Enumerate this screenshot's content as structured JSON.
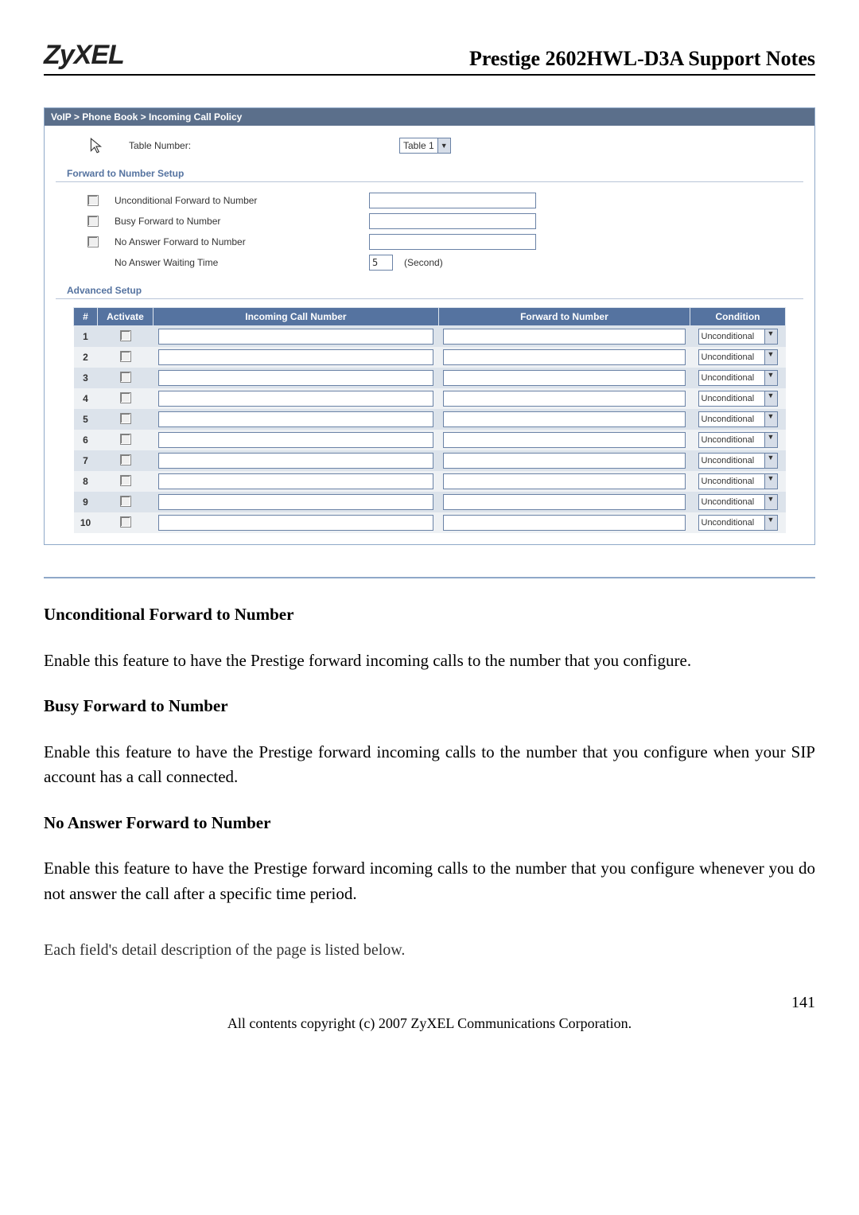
{
  "header": {
    "brand": "ZyXEL",
    "doc_title": "Prestige 2602HWL-D3A Support Notes"
  },
  "breadcrumb": {
    "part1": "VoIP",
    "sep": ">",
    "part2": "Phone Book",
    "part3": "Incoming Call Policy"
  },
  "top": {
    "table_number_label": "Table Number:",
    "table_number_value": "Table 1"
  },
  "fwd_setup": {
    "section": "Forward to Number Setup",
    "row1": "Unconditional Forward to Number",
    "row2": "Busy Forward to Number",
    "row3": "No Answer Forward to Number",
    "row4": "No Answer Waiting Time",
    "wait_val": "5",
    "wait_unit": "(Second)"
  },
  "adv": {
    "section": "Advanced Setup",
    "col_hash": "#",
    "col_activate": "Activate",
    "col_incoming": "Incoming Call Number",
    "col_fwd": "Forward to Number",
    "col_cond": "Condition",
    "cond_val": "Unconditional",
    "rows": [
      "1",
      "2",
      "3",
      "4",
      "5",
      "6",
      "7",
      "8",
      "9",
      "10"
    ]
  },
  "desc": {
    "h1": "Unconditional Forward to Number",
    "p1": "Enable this feature to have the Prestige forward incoming calls to the number that you configure.",
    "h2": "Busy Forward to Number",
    "p2": "Enable this feature to have the Prestige forward incoming calls to the number that you configure when your SIP account has a call connected.",
    "h3": "No Answer Forward to Number",
    "p3": "Enable this feature to have the Prestige forward incoming calls to the number that you configure whenever you do not answer the call after a specific time period.",
    "end": "Each field's detail description of the page is listed below."
  },
  "footer": {
    "page_num": "141",
    "copyright": "All contents copyright (c) 2007 ZyXEL Communications Corporation."
  }
}
